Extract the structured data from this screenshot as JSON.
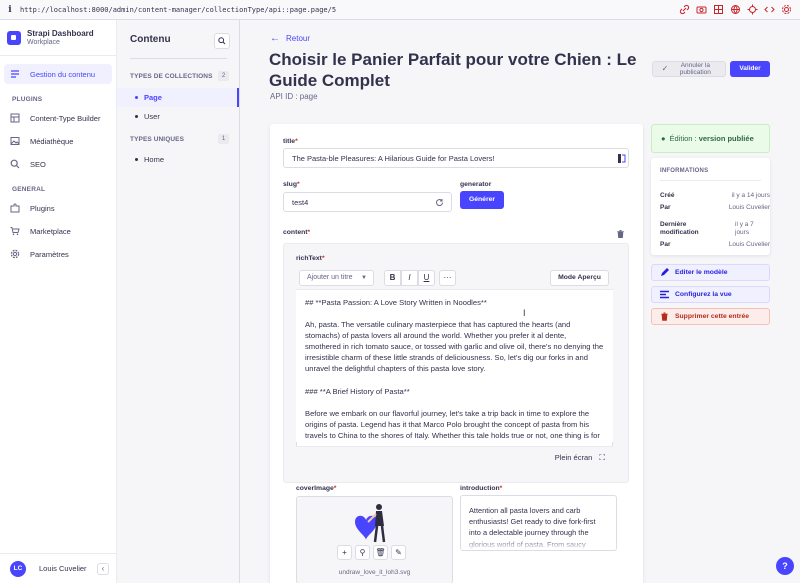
{
  "browser": {
    "url": "http://localhost:8000/admin/content-manager/collectionType/api::page.page/5"
  },
  "brand": {
    "title": "Strapi Dashboard",
    "subtitle": "Workplace"
  },
  "mainnav": {
    "active": "Gestion du contenu",
    "plugins_title": "PLUGINS",
    "plugins": [
      "Content-Type Builder",
      "Médiathèque",
      "SEO"
    ],
    "general_title": "GENERAL",
    "general": [
      "Plugins",
      "Marketplace",
      "Paramètres"
    ]
  },
  "user": {
    "initials": "LC",
    "name": "Louis Cuvelier"
  },
  "subnav": {
    "title": "Contenu",
    "collections_title": "TYPES DE COLLECTIONS",
    "collections_count": "2",
    "collections": [
      "Page",
      "User"
    ],
    "singles_title": "TYPES UNIQUES",
    "singles_count": "1",
    "singles": [
      "Home"
    ]
  },
  "header": {
    "back": "Retour",
    "title": "Choisir le Panier Parfait pour votre Chien : Le Guide Complet",
    "api_id": "API ID : page",
    "unpublish": "Annuler la publication",
    "validate": "Valider"
  },
  "form": {
    "title_label": "title",
    "title_value": "The Pasta-ble Pleasures: A Hilarious Guide for Pasta Lovers!",
    "slug_label": "slug",
    "slug_value": "test4",
    "generator_label": "generator",
    "generate_button": "Générer",
    "content_label": "content",
    "richtext_label": "richText",
    "heading_select": "Ajouter un titre",
    "toolbar_bold": "B",
    "toolbar_italic": "I",
    "toolbar_underline": "U",
    "toolbar_more": "···",
    "mode_button": "Mode Aperçu",
    "fullscreen": "Plein écran",
    "editor_paragraphs": [
      "## **Pasta Passion: A Love Story Written in Noodles**",
      "Ah, pasta. The versatile culinary masterpiece that has captured the hearts (and stomachs) of pasta lovers all around the world. Whether you prefer it al dente, smothered in rich tomato sauce, or tossed with garlic and olive oil, there's no denying the irresistible charm of these little strands of deliciousness. So, let's dig our forks in and unravel the delightful chapters of this pasta love story.",
      "### **A Brief History of Pasta**",
      "Before we embark on our flavorful journey, let's take a trip back in time to explore the origins of pasta. Legend has it that Marco Polo brought the concept of pasta from his travels to China to the shores of Italy. Whether this tale holds true or not, one thing is for"
    ],
    "coverimage_label": "coverImage",
    "coverimage_filename": "undraw_love_it_loh3.svg",
    "introduction_label": "introduction",
    "introduction_value": "Attention all pasta lovers and carb enthusiasts! Get ready to dive fork-first into a delectable journey through the glorious world of pasta. From saucy triumphs to noodle mishaps, this blog"
  },
  "sidebar": {
    "status_prefix": "Édition : ",
    "status_value": "version publiée",
    "info_title": "INFORMATIONS",
    "rows": [
      {
        "key": "Créé",
        "value": "il y a 14 jours"
      },
      {
        "key": "Par",
        "value": "Louis Cuvelier"
      },
      {
        "key": "Dernière modification",
        "value": "il y a 7 jours"
      },
      {
        "key": "Par",
        "value": "Louis Cuvelier"
      }
    ],
    "edit_model": "Editer le modèle",
    "configure_view": "Configurez la vue",
    "delete_entry": "Supprimer cette entrée"
  },
  "help": "?",
  "colors": {
    "primary": "#4945ff",
    "danger": "#d02b20",
    "success_bg": "#eafbe7"
  }
}
